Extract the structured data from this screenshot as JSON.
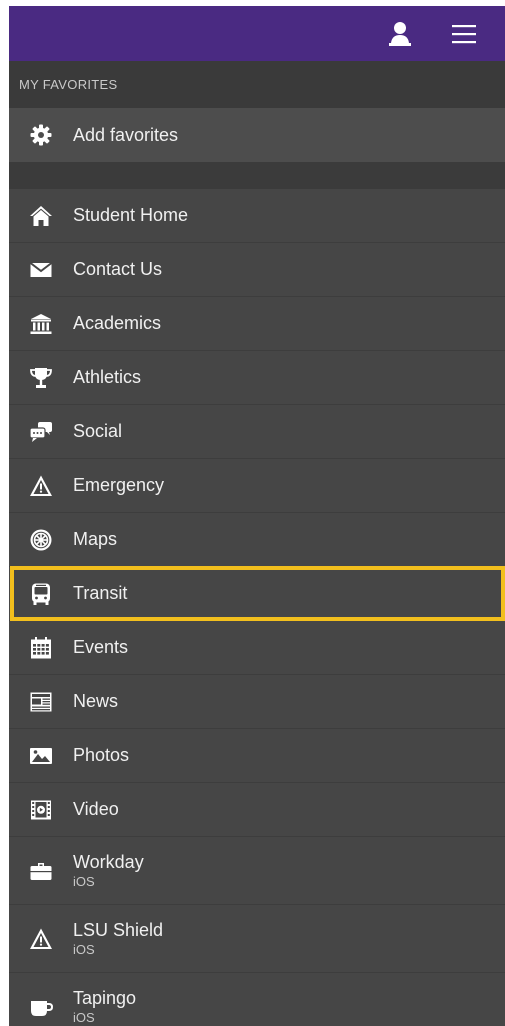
{
  "header": {
    "profile_icon": "user-icon",
    "menu_icon": "hamburger-menu-icon",
    "background": "#4a2a82"
  },
  "favorites": {
    "title": "MY FAVORITES",
    "add_label": "Add favorites",
    "add_icon": "gear-icon"
  },
  "menu": {
    "highlight_color": "#f2bf1d",
    "selected": "Transit",
    "items": [
      {
        "label": "Student Home",
        "icon": "home-icon"
      },
      {
        "label": "Contact Us",
        "icon": "envelope-icon"
      },
      {
        "label": "Academics",
        "icon": "building-icon"
      },
      {
        "label": "Athletics",
        "icon": "trophy-icon"
      },
      {
        "label": "Social",
        "icon": "chat-bubbles-icon"
      },
      {
        "label": "Emergency",
        "icon": "warning-icon"
      },
      {
        "label": "Maps",
        "icon": "map-wheel-icon"
      },
      {
        "label": "Transit",
        "icon": "bus-icon"
      },
      {
        "label": "Events",
        "icon": "calendar-icon"
      },
      {
        "label": "News",
        "icon": "newspaper-icon"
      },
      {
        "label": "Photos",
        "icon": "photo-icon"
      },
      {
        "label": "Video",
        "icon": "film-icon"
      },
      {
        "label": "Workday",
        "sub": "iOS",
        "icon": "briefcase-icon"
      },
      {
        "label": "LSU Shield",
        "sub": "iOS",
        "icon": "warning-icon"
      },
      {
        "label": "Tapingo",
        "sub": "iOS",
        "icon": "coffee-cup-icon"
      }
    ]
  }
}
